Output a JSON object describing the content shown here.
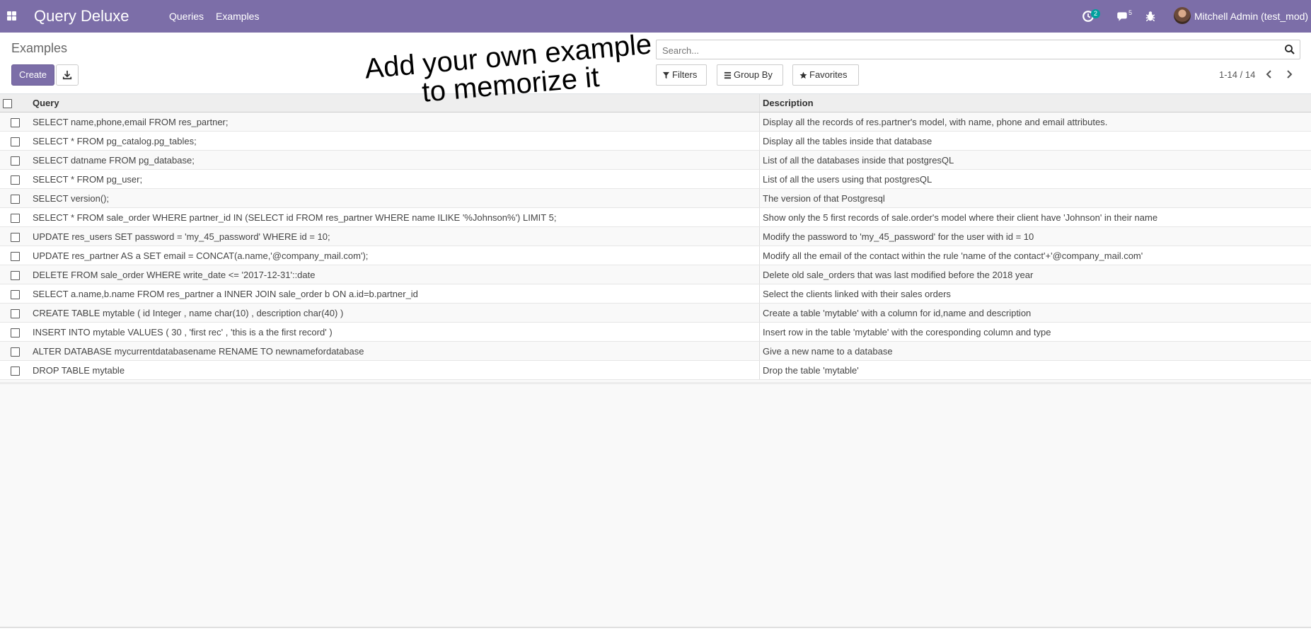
{
  "navbar": {
    "app_title": "Query Deluxe",
    "menu": [
      {
        "label": "Queries"
      },
      {
        "label": "Examples"
      }
    ],
    "activity_count": "2",
    "messages_count": "5",
    "user_name": "Mitchell Admin (test_mod)",
    "accent_color": "#7c6ea8"
  },
  "control_panel": {
    "breadcrumb": "Examples",
    "create_label": "Create",
    "search_placeholder": "Search...",
    "filters_label": "Filters",
    "group_by_label": "Group By",
    "favorites_label": "Favorites",
    "pager_value": "1-14 / 14"
  },
  "annotation": {
    "line1": "Add your own example",
    "line2": "to memorize it"
  },
  "table": {
    "headers": {
      "query": "Query",
      "description": "Description"
    },
    "rows": [
      {
        "query": "SELECT name,phone,email FROM res_partner;",
        "description": "Display all the records of res.partner's model, with name, phone and email attributes."
      },
      {
        "query": "SELECT * FROM pg_catalog.pg_tables;",
        "description": "Display all the tables inside that database"
      },
      {
        "query": "SELECT datname FROM pg_database;",
        "description": "List of all the databases inside that postgresQL"
      },
      {
        "query": "SELECT * FROM pg_user;",
        "description": "List of all the users using that postgresQL"
      },
      {
        "query": "SELECT version();",
        "description": "The version of that Postgresql"
      },
      {
        "query": "SELECT * FROM sale_order WHERE partner_id IN (SELECT id FROM res_partner WHERE name ILIKE '%Johnson%') LIMIT 5;",
        "description": "Show only the 5 first records of sale.order's model where their client have 'Johnson' in their name"
      },
      {
        "query": "UPDATE res_users SET password = 'my_45_password' WHERE id = 10;",
        "description": "Modify the password to 'my_45_password' for the user with id = 10"
      },
      {
        "query": "UPDATE res_partner AS a SET email = CONCAT(a.name,'@company_mail.com');",
        "description": "Modify all the email of the contact within the rule 'name of the contact'+'@company_mail.com'"
      },
      {
        "query": "DELETE FROM sale_order WHERE write_date <= '2017-12-31'::date",
        "description": "Delete old sale_orders that was last modified before the 2018 year"
      },
      {
        "query": "SELECT a.name,b.name FROM res_partner a INNER JOIN sale_order b ON a.id=b.partner_id",
        "description": "Select the clients linked with their sales orders"
      },
      {
        "query": "CREATE TABLE mytable ( id Integer , name char(10) , description char(40) )",
        "description": "Create a table 'mytable' with a column for id,name and description"
      },
      {
        "query": "INSERT INTO mytable VALUES ( 30 , 'first rec' , 'this is a the first record' )",
        "description": "Insert row in the table 'mytable' with the coresponding column and type"
      },
      {
        "query": "ALTER DATABASE mycurrentdatabasename RENAME TO newnamefordatabase",
        "description": "Give a new name to a database"
      },
      {
        "query": "DROP TABLE mytable",
        "description": "Drop the table 'mytable'"
      }
    ]
  }
}
